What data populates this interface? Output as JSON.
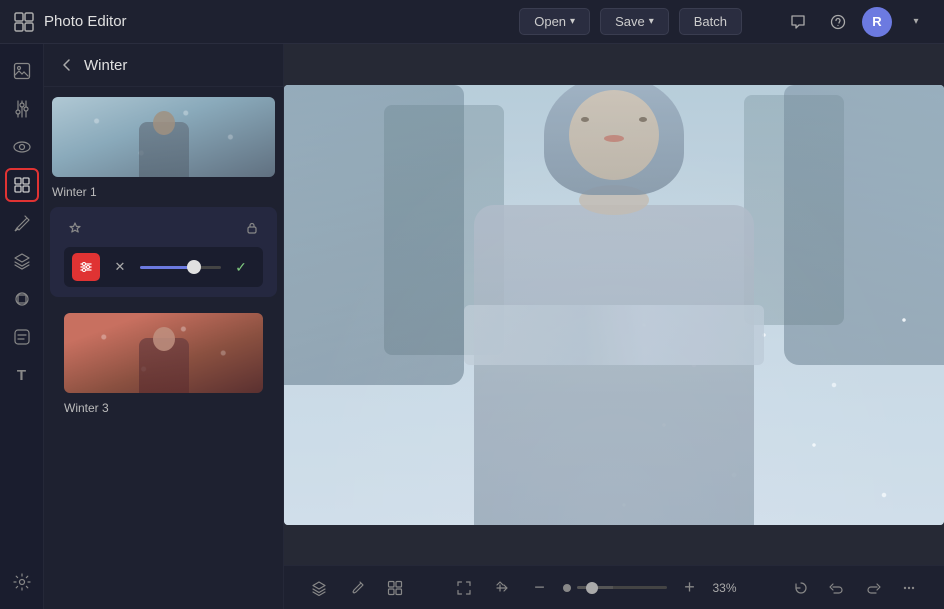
{
  "app": {
    "title": "Photo Editor",
    "logo_icon": "⊞"
  },
  "topbar": {
    "open_label": "Open",
    "save_label": "Save",
    "batch_label": "Batch",
    "chat_icon": "💬",
    "help_icon": "?",
    "avatar_letter": "R",
    "chevron": "▾"
  },
  "sidebar": {
    "icons": [
      {
        "name": "image-icon",
        "symbol": "🖼",
        "label": "Image"
      },
      {
        "name": "adjustments-icon",
        "symbol": "⚙",
        "label": "Adjustments"
      },
      {
        "name": "eye-icon",
        "symbol": "◉",
        "label": "Preview"
      },
      {
        "name": "effects-icon",
        "symbol": "✦",
        "label": "Effects",
        "active": true
      },
      {
        "name": "brush-icon",
        "symbol": "✎",
        "label": "Brush"
      },
      {
        "name": "layers-icon",
        "symbol": "⊟",
        "label": "Layers"
      },
      {
        "name": "shapes-icon",
        "symbol": "❖",
        "label": "Shapes"
      },
      {
        "name": "filters-icon",
        "symbol": "◈",
        "label": "Filters"
      },
      {
        "name": "text-icon",
        "symbol": "T",
        "label": "Text"
      },
      {
        "name": "settings-icon",
        "symbol": "⚙",
        "label": "Settings"
      }
    ]
  },
  "effects_panel": {
    "back_icon": "←",
    "title": "Winter",
    "lock_icon": "🔒",
    "star_icon": "☆",
    "items": [
      {
        "id": "winter1",
        "label": "Winter 1",
        "active": true
      },
      {
        "id": "winter3",
        "label": "Winter 3",
        "active": false
      }
    ],
    "active_item": {
      "favorite_icon": "☆",
      "lock_icon": "🔒",
      "settings_icon": "⊞",
      "cancel_icon": "✕",
      "confirm_icon": "✓",
      "slider_value": 70
    }
  },
  "canvas": {
    "zoom_percent": "33%"
  },
  "bottombar": {
    "layers_icon": "⊟",
    "edit_icon": "✎",
    "grid_icon": "⊞",
    "fit_icon": "⛶",
    "transform_icon": "⇄",
    "zoom_out_icon": "−",
    "zoom_in_icon": "+",
    "zoom_value": 33,
    "zoom_label": "33%",
    "undo_refresh_icon": "↺",
    "undo_icon": "↩",
    "redo_icon": "↪",
    "more_icon": "⋯"
  }
}
